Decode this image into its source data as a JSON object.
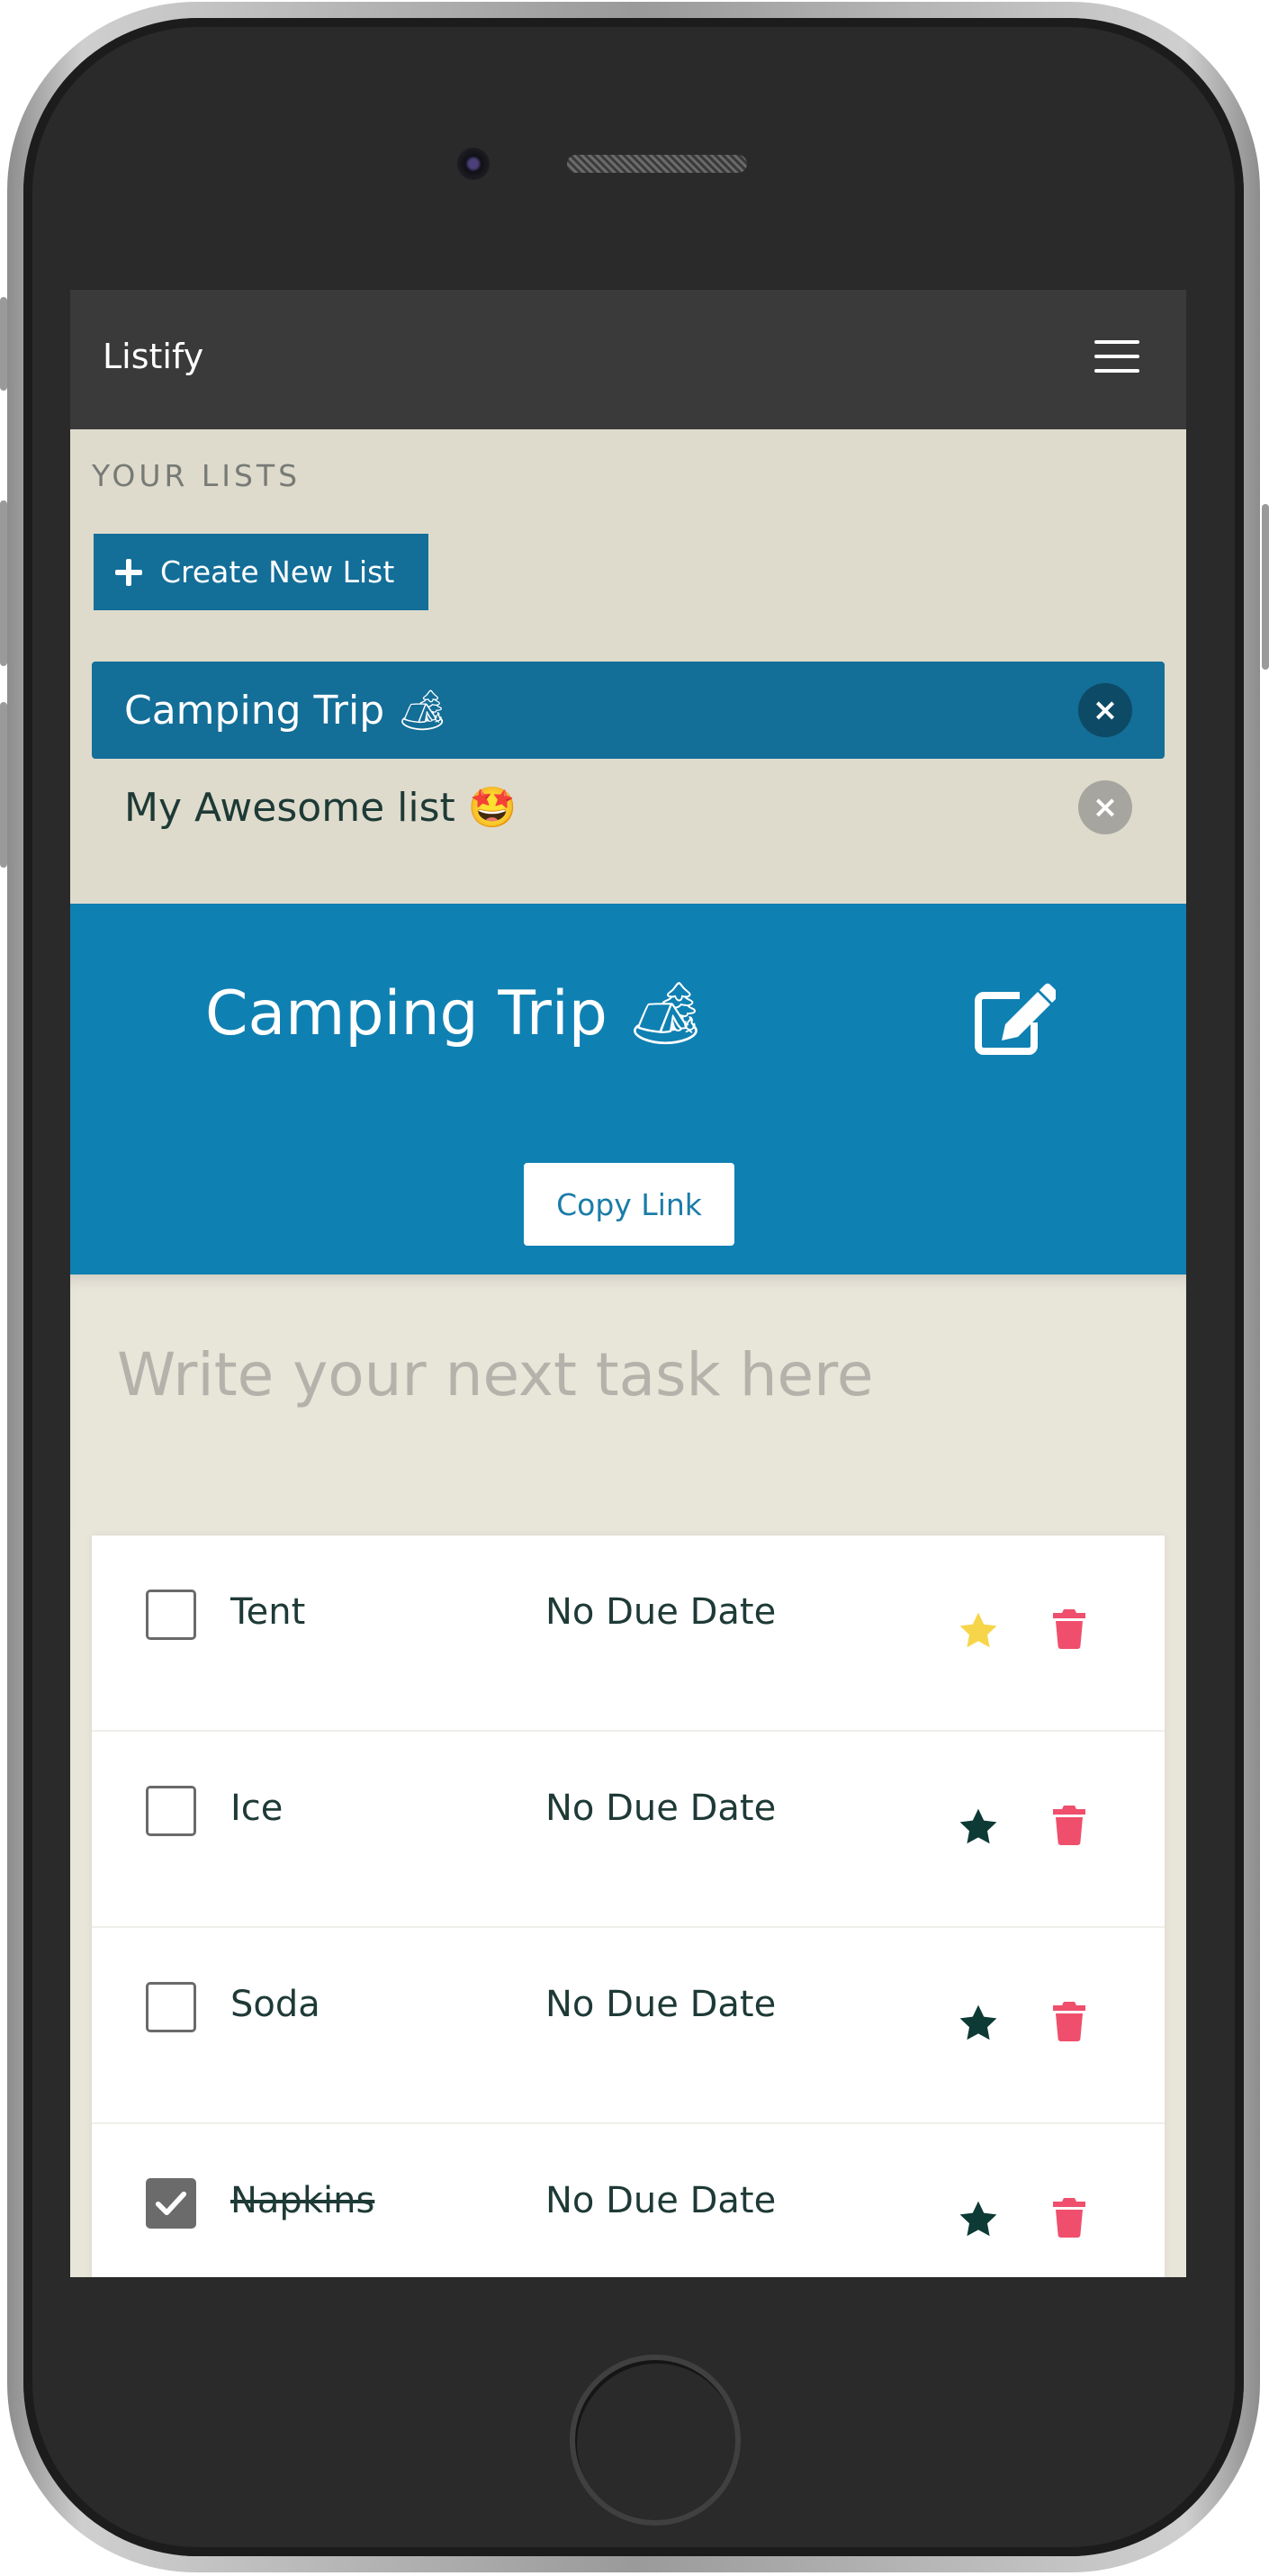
{
  "app": {
    "brand": "Listify"
  },
  "lists_panel": {
    "heading": "YOUR LISTS",
    "create_label": "Create New List",
    "items": [
      {
        "label": "Camping Trip 🏕",
        "active": true,
        "remove_symbol": "×"
      },
      {
        "label": "My Awesome list 🤩",
        "active": false,
        "remove_symbol": "×"
      }
    ]
  },
  "list_view": {
    "title": "Camping Trip 🏕",
    "copy_link_label": "Copy Link",
    "task_placeholder": "Write your next task here"
  },
  "tasks": [
    {
      "name": "Tent",
      "due": "No Due Date",
      "done": false,
      "starred": true
    },
    {
      "name": "Ice",
      "due": "No Due Date",
      "done": false,
      "starred": false
    },
    {
      "name": "Soda",
      "due": "No Due Date",
      "done": false,
      "starred": false
    },
    {
      "name": "Napkins",
      "due": "No Due Date",
      "done": true,
      "starred": false
    }
  ],
  "colors": {
    "navbar": "#3a3a3a",
    "accent": "#136e98",
    "banner": "#0f80b2",
    "star_active": "#f7d54a",
    "star_inactive": "#0e3a36",
    "trash": "#ef4f6c"
  }
}
